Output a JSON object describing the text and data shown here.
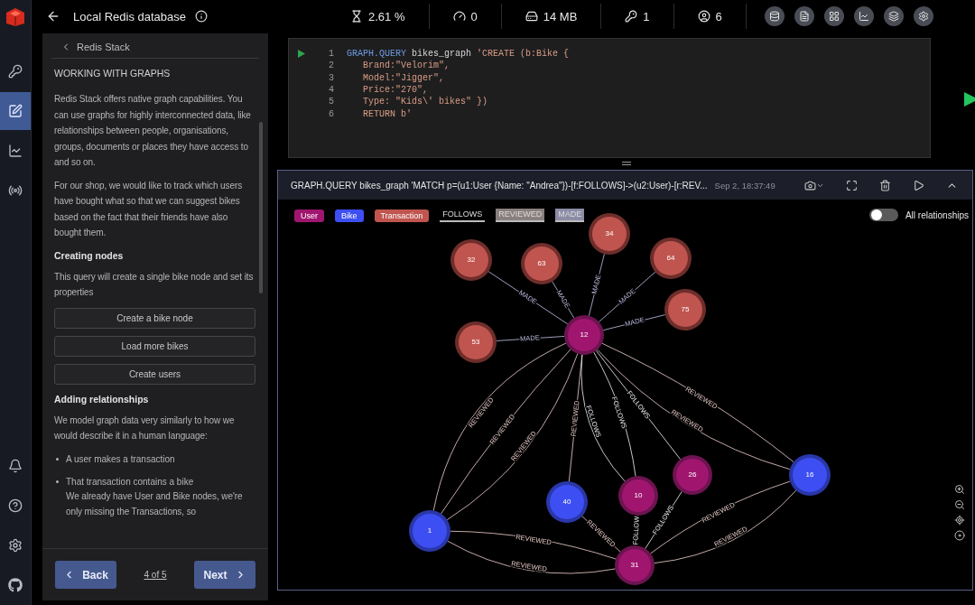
{
  "topbar": {
    "title": "Local Redis database",
    "stats": [
      {
        "kind": "cpu",
        "value": "2.61 %"
      },
      {
        "kind": "ops",
        "value": "0"
      },
      {
        "kind": "memory",
        "value": "14 MB"
      },
      {
        "kind": "keys",
        "value": "1"
      },
      {
        "kind": "clients",
        "value": "6"
      }
    ],
    "tools": [
      {
        "kind": "stack"
      },
      {
        "kind": "file"
      },
      {
        "kind": "grid"
      },
      {
        "kind": "chart"
      },
      {
        "kind": "layers"
      },
      {
        "kind": "settings"
      }
    ]
  },
  "rail": {
    "items": [
      {
        "kind": "browser",
        "selected": false
      },
      {
        "kind": "workbench",
        "selected": true
      },
      {
        "kind": "analysis",
        "selected": false
      },
      {
        "kind": "pubsub",
        "selected": false
      }
    ],
    "bottom": [
      {
        "kind": "notifications"
      },
      {
        "kind": "help"
      },
      {
        "kind": "settings"
      },
      {
        "kind": "github"
      }
    ]
  },
  "guide": {
    "back_label": "Redis Stack",
    "heading": "WORKING WITH GRAPHS",
    "blocks": [
      {
        "kind": "paragraph",
        "text": "Redis Stack offers native graph capabilities. You can use graphs for highly interconnected data, like relationships between people, organisations, groups, documents or places they have access to and so on."
      },
      {
        "kind": "paragraph",
        "text": "For our shop, we would like to track which users have bought what so that we can suggest bikes based on the fact that their friends have also bought them."
      },
      {
        "kind": "subheading",
        "text": "Creating nodes"
      },
      {
        "kind": "paragraph",
        "text": "This query will create a single bike node and set its properties"
      },
      {
        "kind": "button",
        "text": "Create a bike node"
      },
      {
        "kind": "button",
        "text": "Load more bikes"
      },
      {
        "kind": "button",
        "text": "Create users"
      },
      {
        "kind": "subheading",
        "text": "Adding relationships"
      },
      {
        "kind": "paragraph",
        "text": "We model graph data very similarly to how we would describe it in a human language:"
      },
      {
        "kind": "bullet",
        "text": "A user makes a transaction"
      },
      {
        "kind": "bullet",
        "text": "That transaction contains a bike"
      },
      {
        "kind": "note",
        "text": "We already have User and Bike nodes, we're only missing the Transactions, so"
      }
    ],
    "footer": {
      "back": "Back",
      "page": "4 of 5",
      "next": "Next"
    }
  },
  "editor": {
    "lines": [
      {
        "number": "1",
        "segments": [
          {
            "kind": "keyword",
            "text": "GRAPH.QUERY"
          },
          {
            "kind": "plain",
            "text": " bikes_graph "
          },
          {
            "kind": "string",
            "text": "'CREATE (b:Bike {"
          }
        ]
      },
      {
        "number": "2",
        "segments": [
          {
            "kind": "string",
            "text": "   Brand:\"Velorim\","
          }
        ]
      },
      {
        "number": "3",
        "segments": [
          {
            "kind": "string",
            "text": "   Model:\"Jigger\","
          }
        ]
      },
      {
        "number": "4",
        "segments": [
          {
            "kind": "string",
            "text": "   Price:\"270\","
          }
        ]
      },
      {
        "number": "5",
        "segments": [
          {
            "kind": "string",
            "text": "   Type: \"Kids\\' bikes\" })"
          }
        ]
      },
      {
        "number": "6",
        "segments": [
          {
            "kind": "string",
            "text": "   RETURN b'"
          }
        ]
      }
    ]
  },
  "result": {
    "query": "GRAPH.QUERY bikes_graph 'MATCH p=(u1:User {Name: \"Andrea\"})-[f:FOLLOWS]->(u2:User)-[r:REV...",
    "time": "Sep 2, 18:37:49",
    "legend": [
      {
        "kind": "node",
        "label": "User",
        "color": "#a0166f"
      },
      {
        "kind": "node",
        "label": "Bike",
        "color": "#3d4ff2"
      },
      {
        "kind": "node",
        "label": "Transaction",
        "color": "#c0554f"
      },
      {
        "kind": "edge",
        "label": "FOLLOWS",
        "color": "#000000"
      },
      {
        "kind": "edge",
        "label": "REVIEWED",
        "color": "#8a7f7f"
      },
      {
        "kind": "edge",
        "label": "MADE",
        "color": "#8c8ca6"
      }
    ],
    "all_relationships": {
      "label": "All relationships",
      "on": false
    },
    "graph": {
      "nodes": [
        {
          "label": "12",
          "kind": "user"
        },
        {
          "label": "32",
          "kind": "transaction"
        },
        {
          "label": "63",
          "kind": "transaction"
        },
        {
          "label": "34",
          "kind": "transaction"
        },
        {
          "label": "64",
          "kind": "transaction"
        },
        {
          "label": "75",
          "kind": "transaction"
        },
        {
          "label": "53",
          "kind": "transaction"
        },
        {
          "label": "26",
          "kind": "user"
        },
        {
          "label": "10",
          "kind": "user"
        },
        {
          "label": "40",
          "kind": "bike"
        },
        {
          "label": "1",
          "kind": "bike"
        },
        {
          "label": "31",
          "kind": "user"
        },
        {
          "label": "16",
          "kind": "bike"
        }
      ],
      "links": [
        {
          "kind": "made",
          "label": "MADE"
        },
        {
          "kind": "made",
          "label": "MADE"
        },
        {
          "kind": "made",
          "label": "MADE"
        },
        {
          "kind": "made",
          "label": "MADE"
        },
        {
          "kind": "made",
          "label": "MADE"
        },
        {
          "kind": "made",
          "label": "MADE"
        },
        {
          "kind": "reviewed",
          "label": "REVIEWED"
        },
        {
          "kind": "reviewed",
          "label": "REVIEWED"
        },
        {
          "kind": "reviewed",
          "label": "REVIEWED"
        },
        {
          "kind": "reviewed",
          "label": "REVIEWED"
        },
        {
          "kind": "follows",
          "label": "FOLLOWS"
        },
        {
          "kind": "follows",
          "label": "FOLLOWS"
        },
        {
          "kind": "follows",
          "label": "FOLLOWS"
        },
        {
          "kind": "reviewed",
          "label": "REVIEWED"
        },
        {
          "kind": "reviewed",
          "label": "REVIEWED"
        },
        {
          "kind": "reviewed",
          "label": "REVIEWED"
        },
        {
          "kind": "reviewed",
          "label": "REVIEWED"
        },
        {
          "kind": "reviewed",
          "label": "REVIEWED"
        },
        {
          "kind": "follows",
          "label": "FOLLOW"
        },
        {
          "kind": "follows",
          "label": "FOLLOWS"
        },
        {
          "kind": "reviewed",
          "label": "REVIEWED"
        },
        {
          "kind": "reviewed",
          "label": "REVIEWED"
        }
      ]
    }
  }
}
